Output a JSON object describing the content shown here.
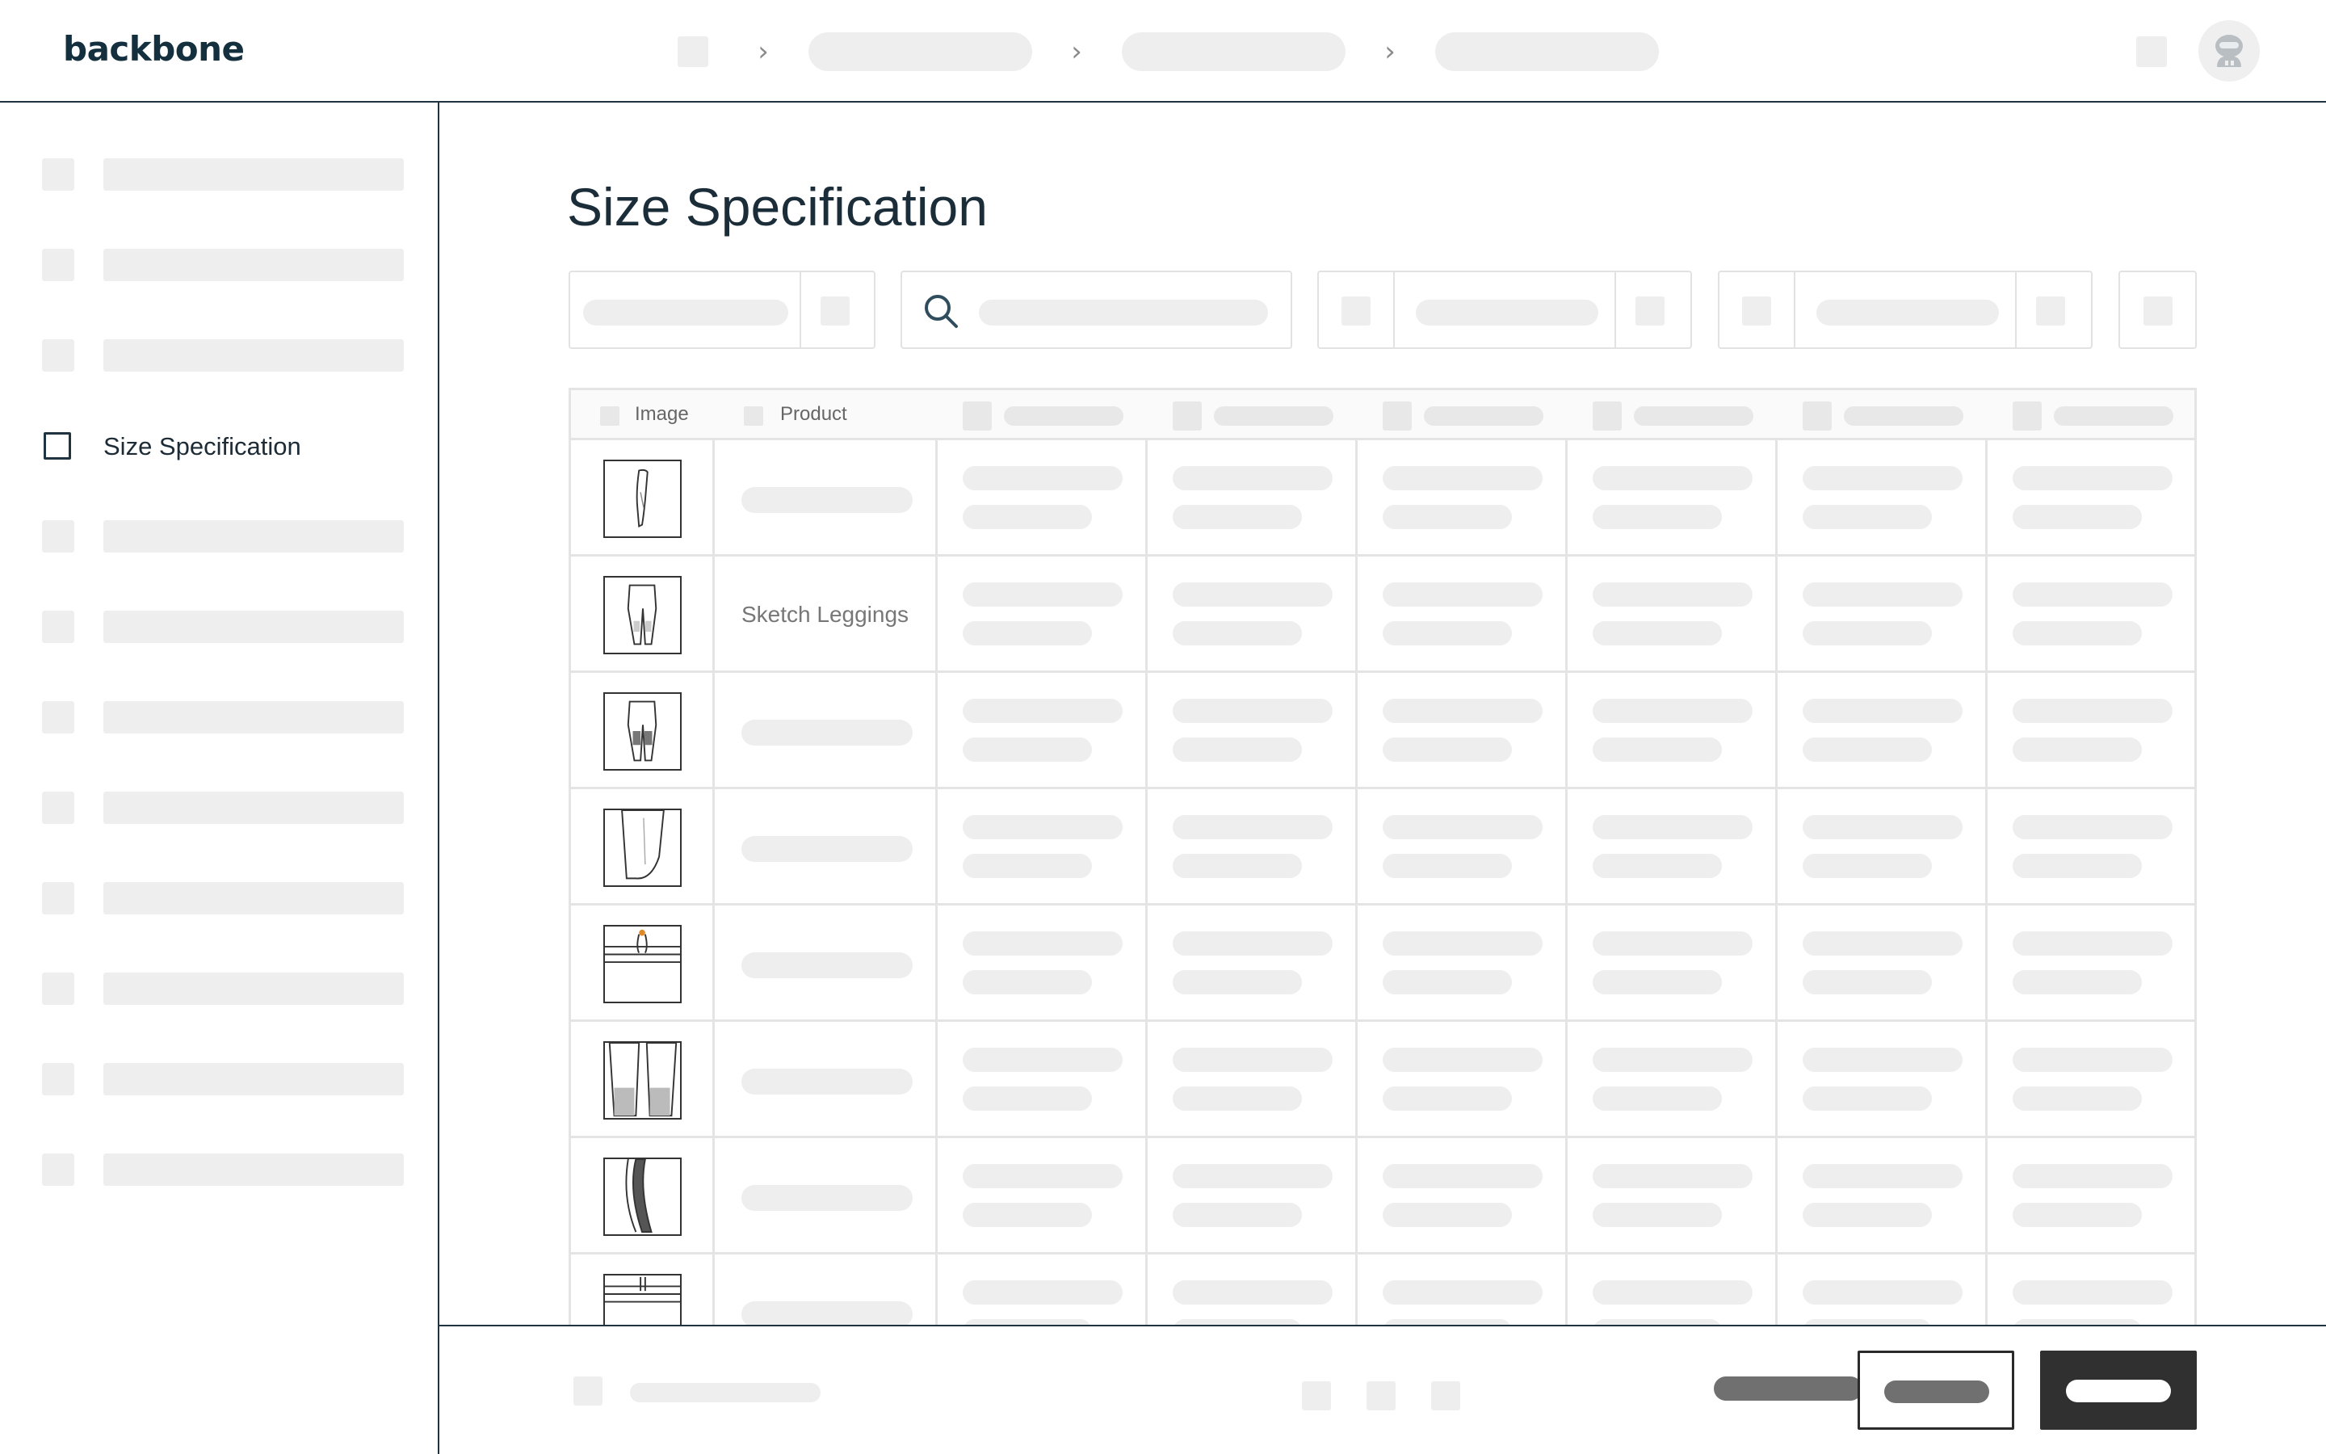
{
  "app": {
    "logo_text": "backbone"
  },
  "header": {
    "breadcrumb": [
      {
        "icon": "home-icon"
      },
      {
        "label": ""
      },
      {
        "label": ""
      },
      {
        "label": ""
      }
    ],
    "icons": [
      "notification-icon",
      "avatar-icon"
    ]
  },
  "sidebar": {
    "active_item": {
      "label": "Size Specification",
      "icon": "checkbox-icon"
    }
  },
  "main": {
    "title": "Size Specification",
    "search": {
      "icon": "search-icon",
      "placeholder": ""
    }
  },
  "table": {
    "columns": [
      "Image",
      "Product",
      "",
      "",
      "",
      "",
      "",
      ""
    ],
    "rows": [
      {
        "image": "leggings-side-sketch",
        "product": ""
      },
      {
        "image": "leggings-front-sketch",
        "product": "Sketch Leggings"
      },
      {
        "image": "leggings-back-sketch",
        "product": ""
      },
      {
        "image": "leg-detail-sketch",
        "product": ""
      },
      {
        "image": "waistband-sketch",
        "product": ""
      },
      {
        "image": "knee-panel-sketch",
        "product": ""
      },
      {
        "image": "side-seam-sketch",
        "product": ""
      },
      {
        "image": "waistband-detail-sketch",
        "product": ""
      }
    ]
  },
  "colors": {
    "accent": "#1f3340",
    "logo": "#14303e",
    "placeholder": "#eeeeee",
    "primary_button": "#303030"
  }
}
